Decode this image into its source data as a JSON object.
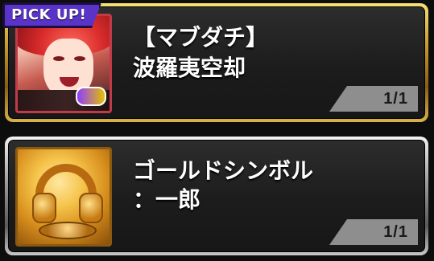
{
  "pickup_badge": {
    "label": "PICK UP!"
  },
  "items": [
    {
      "title_line1": "【マブダチ】",
      "title_line2": "波羅夷空却",
      "count": "1/1",
      "thumbnail_icon": "character-portrait",
      "frame_color": "#d4a83a"
    },
    {
      "title_line1": "ゴールドシンボル",
      "title_line2": "：一郎",
      "count": "1/1",
      "thumbnail_icon": "gold-headphones-symbol",
      "frame_color": "#bfbfbf"
    }
  ],
  "colors": {
    "pickup_bg": "#5a34c8",
    "card_bg": "#1c1c1c",
    "count_tab": "#8e8e8e"
  }
}
